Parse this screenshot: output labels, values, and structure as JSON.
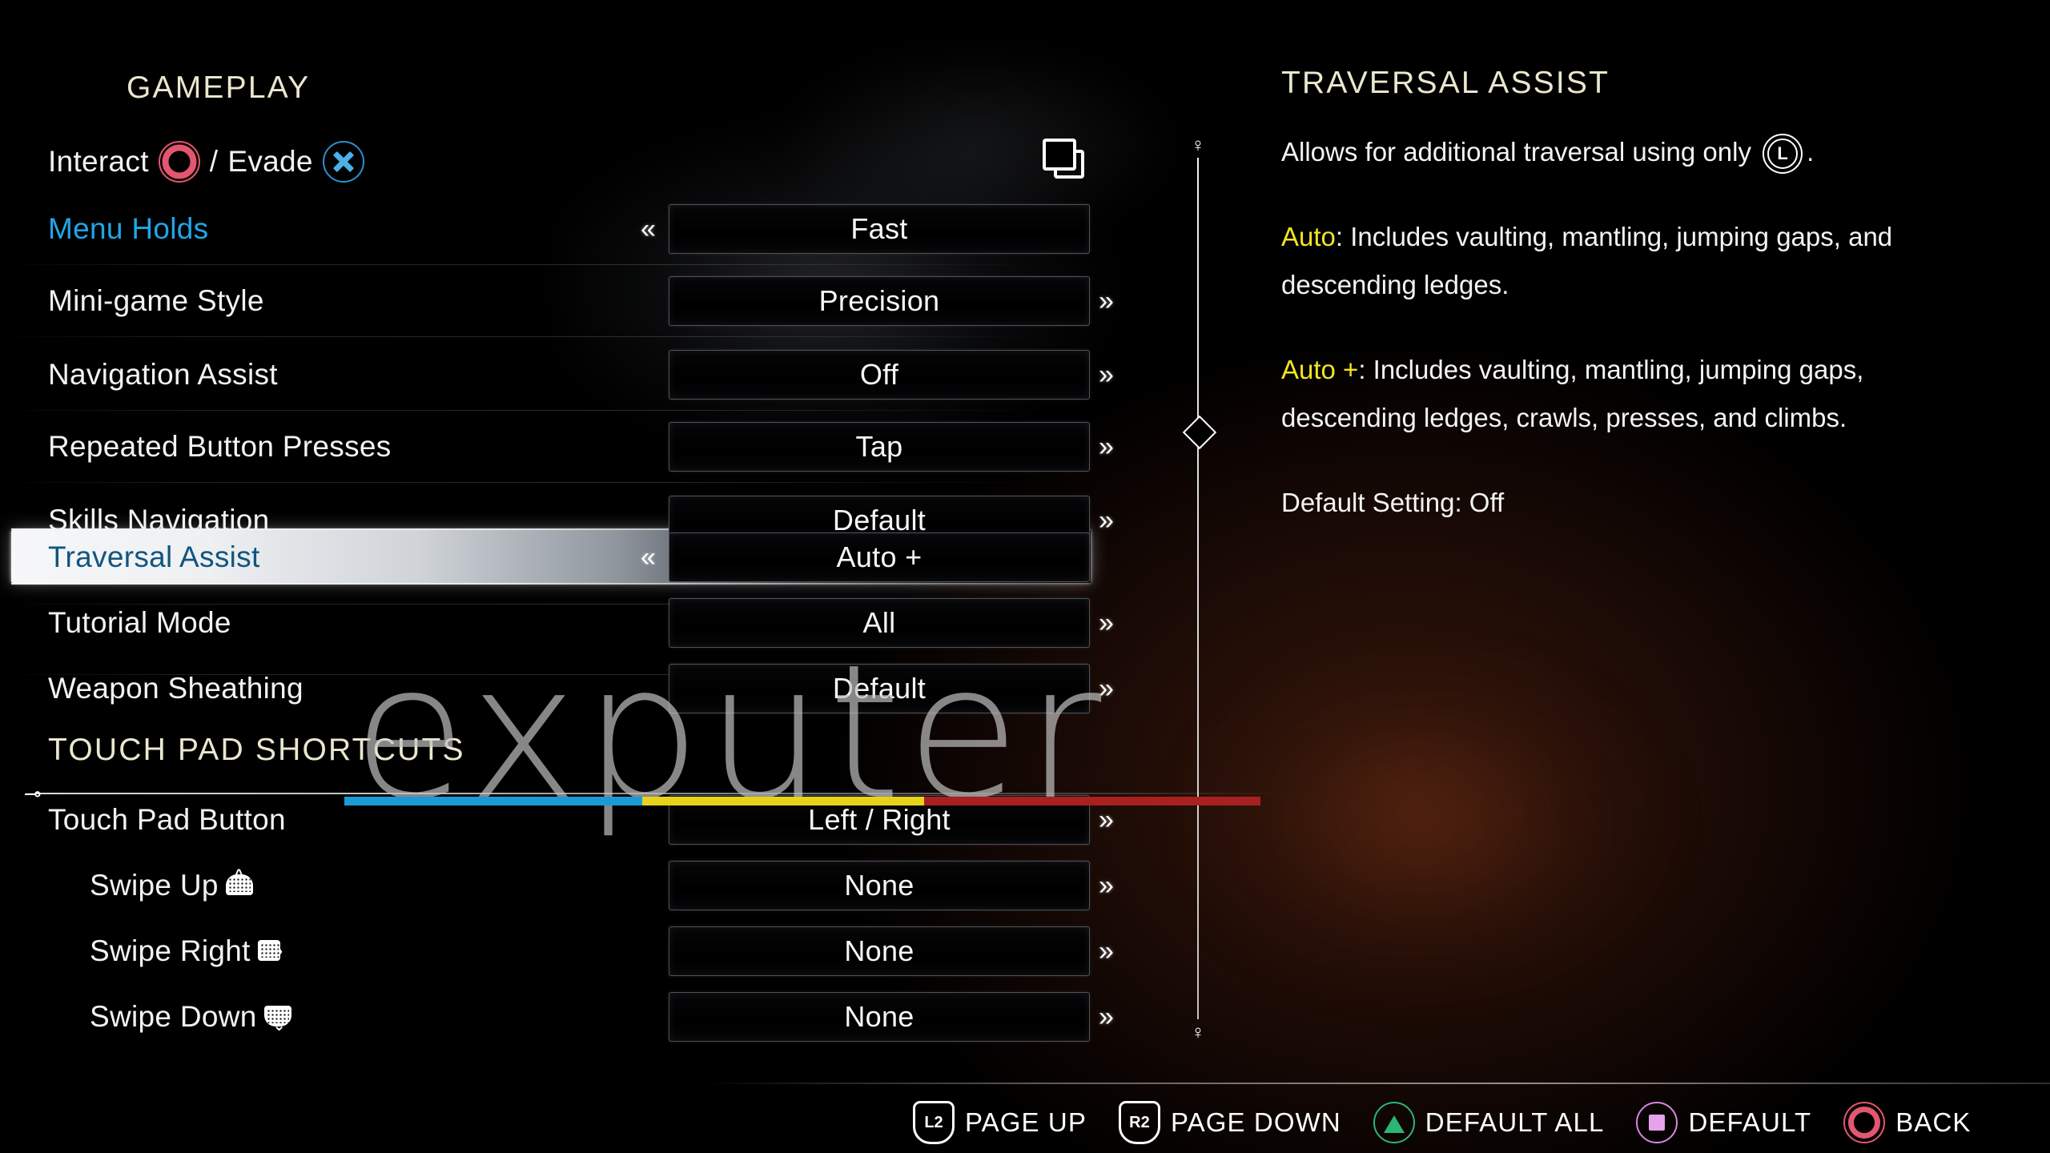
{
  "left_panel": {
    "section_title": "GAMEPLAY",
    "control_hint": {
      "interact_label": "Interact",
      "separator": "/",
      "evade_label": "Evade",
      "circle_icon": "ps-circle-button-icon",
      "cross_icon": "ps-cross-button-icon",
      "touchpad_icon": "touchpad-copy-icon"
    },
    "rows": [
      {
        "label": "Menu Holds",
        "value": "Fast",
        "state": "cyan",
        "arrow": "left",
        "arrow_glyph": "«"
      },
      {
        "label": "Mini-game Style",
        "value": "Precision",
        "state": "normal",
        "arrow": "right",
        "arrow_glyph": "»"
      },
      {
        "label": "Navigation Assist",
        "value": "Off",
        "state": "normal",
        "arrow": "right",
        "arrow_glyph": "»"
      },
      {
        "label": "Repeated Button Presses",
        "value": "Tap",
        "state": "normal",
        "arrow": "right",
        "arrow_glyph": "»"
      },
      {
        "label": "Skills Navigation",
        "value": "Default",
        "state": "normal",
        "arrow": "right",
        "arrow_glyph": "»"
      },
      {
        "label": "Traversal Assist",
        "value": "Auto +",
        "state": "selected",
        "arrow": "left",
        "arrow_glyph": "«"
      },
      {
        "label": "Tutorial Mode",
        "value": "All",
        "state": "normal",
        "arrow": "right",
        "arrow_glyph": "»"
      },
      {
        "label": "Weapon Sheathing",
        "value": "Default",
        "state": "normal",
        "arrow": "right",
        "arrow_glyph": "»"
      }
    ],
    "touchpad_section_title": "TOUCH PAD SHORTCUTS",
    "touchpad_rows": [
      {
        "label": "Touch Pad Button",
        "value": "Left / Right",
        "gesture": "none",
        "arrow_glyph": "»"
      },
      {
        "label": "Swipe Up",
        "value": "None",
        "gesture": "up",
        "arrow_glyph": "»"
      },
      {
        "label": "Swipe Right",
        "value": "None",
        "gesture": "right",
        "arrow_glyph": "»"
      },
      {
        "label": "Swipe Down",
        "value": "None",
        "gesture": "down",
        "arrow_glyph": "»"
      }
    ]
  },
  "scrollbar": {
    "top_cap_glyph": "♀",
    "bottom_cap_glyph": "♀",
    "thumb_icon": "diamond-scroll-thumb-icon"
  },
  "right_panel": {
    "title": "TRAVERSAL ASSIST",
    "intro_before": "Allows for additional traversal using only",
    "l_button_label": "L",
    "intro_after": ".",
    "auto_label": "Auto",
    "auto_text": ": Includes vaulting, mantling, jumping gaps, and descending ledges.",
    "autoplus_label": "Auto +",
    "autoplus_text": ": Includes vaulting, mantling, jumping gaps, descending ledges, crawls, presses, and climbs.",
    "default_line": "Default Setting: Off"
  },
  "bottom_bar": {
    "items": [
      {
        "glyph": "L2",
        "label": "PAGE UP",
        "icon": "trigger-l2-icon",
        "kind": "trigger"
      },
      {
        "glyph": "R2",
        "label": "PAGE DOWN",
        "icon": "trigger-r2-icon",
        "kind": "trigger"
      },
      {
        "glyph": "",
        "label": "DEFAULT ALL",
        "icon": "ps-triangle-button-icon",
        "kind": "tri"
      },
      {
        "glyph": "",
        "label": "DEFAULT",
        "icon": "ps-square-button-icon",
        "kind": "sq"
      },
      {
        "glyph": "",
        "label": "BACK",
        "icon": "ps-circle-button-icon",
        "kind": "cir"
      }
    ]
  },
  "watermark": {
    "text": "exputer",
    "bar_blue": "#1b9ad6",
    "bar_yellow": "#e8d21a",
    "bar_red": "#a82020"
  },
  "colors": {
    "heading": "#eae7cf",
    "cyan_row": "#21a6e8",
    "selected_row_text": "#11557e",
    "highlight_yellow": "#f2e324",
    "ps_circle": "#e2566f",
    "ps_cross": "#49b2e8",
    "ps_triangle": "#2bb673",
    "ps_square": "#e4a3ea"
  }
}
